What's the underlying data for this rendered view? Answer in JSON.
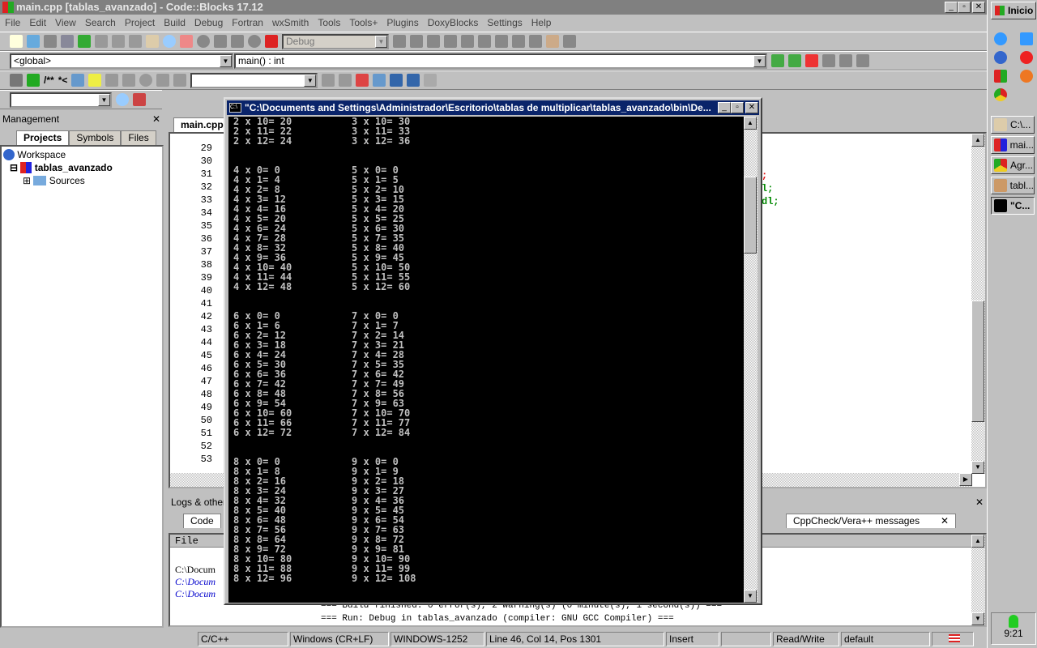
{
  "window": {
    "title": "main.cpp [tablas_avanzado] - Code::Blocks 17.12",
    "min": "_",
    "max": "▫",
    "close": "✕"
  },
  "menu": [
    "File",
    "Edit",
    "View",
    "Search",
    "Project",
    "Build",
    "Debug",
    "Fortran",
    "wxSmith",
    "Tools",
    "Tools+",
    "Plugins",
    "DoxyBlocks",
    "Settings",
    "Help"
  ],
  "toolbar": {
    "build_target": "Debug",
    "scope": "<global>",
    "function": "main() : int",
    "doxy1": "/**",
    "doxy2": "*<",
    "search_combo": "",
    "small_combo": ""
  },
  "management": {
    "title": "Management",
    "close": "✕",
    "tabs": [
      "Projects",
      "Symbols",
      "Files"
    ],
    "tree": {
      "workspace": "Workspace",
      "project": "tablas_avanzado",
      "folder": "Sources"
    }
  },
  "editor": {
    "tab": "main.cpp",
    "line_numbers": [
      "29",
      "30",
      "31",
      "32",
      "33",
      "34",
      "35",
      "36",
      "37",
      "38",
      "39",
      "40",
      "41",
      "42",
      "43",
      "44",
      "45",
      "46",
      "47",
      "48",
      "49",
      "50",
      "51",
      "52",
      "53"
    ],
    "code_fragments": [
      ";",
      "l;",
      "dl;"
    ]
  },
  "console": {
    "title": "\"C:\\Documents and Settings\\Administrador\\Escritorio\\tablas de multiplicar\\tablas_avanzado\\bin\\De...",
    "rows": [
      [
        "2 x 10= 20",
        "3 x 10= 30"
      ],
      [
        "2 x 11= 22",
        "3 x 11= 33"
      ],
      [
        "2 x 12= 24",
        "3 x 12= 36"
      ],
      [
        "",
        ""
      ],
      [
        "",
        ""
      ],
      [
        "4 x 0= 0",
        "5 x 0= 0"
      ],
      [
        "4 x 1= 4",
        "5 x 1= 5"
      ],
      [
        "4 x 2= 8",
        "5 x 2= 10"
      ],
      [
        "4 x 3= 12",
        "5 x 3= 15"
      ],
      [
        "4 x 4= 16",
        "5 x 4= 20"
      ],
      [
        "4 x 5= 20",
        "5 x 5= 25"
      ],
      [
        "4 x 6= 24",
        "5 x 6= 30"
      ],
      [
        "4 x 7= 28",
        "5 x 7= 35"
      ],
      [
        "4 x 8= 32",
        "5 x 8= 40"
      ],
      [
        "4 x 9= 36",
        "5 x 9= 45"
      ],
      [
        "4 x 10= 40",
        "5 x 10= 50"
      ],
      [
        "4 x 11= 44",
        "5 x 11= 55"
      ],
      [
        "4 x 12= 48",
        "5 x 12= 60"
      ],
      [
        "",
        ""
      ],
      [
        "",
        ""
      ],
      [
        "6 x 0= 0",
        "7 x 0= 0"
      ],
      [
        "6 x 1= 6",
        "7 x 1= 7"
      ],
      [
        "6 x 2= 12",
        "7 x 2= 14"
      ],
      [
        "6 x 3= 18",
        "7 x 3= 21"
      ],
      [
        "6 x 4= 24",
        "7 x 4= 28"
      ],
      [
        "6 x 5= 30",
        "7 x 5= 35"
      ],
      [
        "6 x 6= 36",
        "7 x 6= 42"
      ],
      [
        "6 x 7= 42",
        "7 x 7= 49"
      ],
      [
        "6 x 8= 48",
        "7 x 8= 56"
      ],
      [
        "6 x 9= 54",
        "7 x 9= 63"
      ],
      [
        "6 x 10= 60",
        "7 x 10= 70"
      ],
      [
        "6 x 11= 66",
        "7 x 11= 77"
      ],
      [
        "6 x 12= 72",
        "7 x 12= 84"
      ],
      [
        "",
        ""
      ],
      [
        "",
        ""
      ],
      [
        "8 x 0= 0",
        "9 x 0= 0"
      ],
      [
        "8 x 1= 8",
        "9 x 1= 9"
      ],
      [
        "8 x 2= 16",
        "9 x 2= 18"
      ],
      [
        "8 x 3= 24",
        "9 x 3= 27"
      ],
      [
        "8 x 4= 32",
        "9 x 4= 36"
      ],
      [
        "8 x 5= 40",
        "9 x 5= 45"
      ],
      [
        "8 x 6= 48",
        "9 x 6= 54"
      ],
      [
        "8 x 7= 56",
        "9 x 7= 63"
      ],
      [
        "8 x 8= 64",
        "9 x 8= 72"
      ],
      [
        "8 x 9= 72",
        "9 x 9= 81"
      ],
      [
        "8 x 10= 80",
        "9 x 10= 90"
      ],
      [
        "8 x 11= 88",
        "9 x 11= 99"
      ],
      [
        "8 x 12= 96",
        "9 x 12= 108"
      ]
    ]
  },
  "logs": {
    "title": "Logs & others",
    "close": "✕",
    "tabs": [
      "Code",
      "CppCheck/Vera++ messages"
    ],
    "column": "File",
    "lines": [
      "C:\\Docum",
      "C:\\Docum",
      "C:\\Docum"
    ],
    "build_msg": "=== Build finished: 0 error(s), 2 warning(s) (0 minute(s), 1 second(s)) ===",
    "run_msg": "=== Run: Debug in tablas_avanzado (compiler: GNU GCC Compiler) ==="
  },
  "status": [
    "C/C++",
    "Windows (CR+LF)",
    "WINDOWS-1252",
    "Line 46, Col 14, Pos 1301",
    "Insert",
    "",
    "Read/Write",
    "default"
  ],
  "taskbar": {
    "start": "Inicio",
    "buttons": [
      "C:\\...",
      "mai...",
      "Agr...",
      "tabl...",
      "\"C..."
    ],
    "clock": "9:21"
  }
}
